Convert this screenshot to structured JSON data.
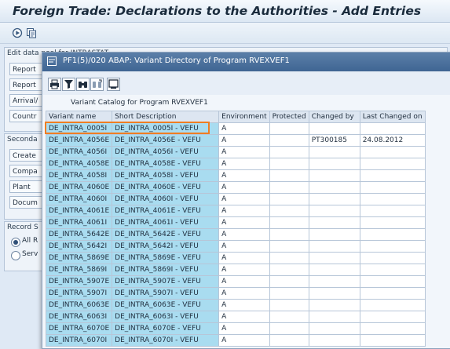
{
  "window": {
    "title": "Foreign Trade: Declarations to the Authorities - Add Entries"
  },
  "toolbar": {
    "icons": [
      "execute-icon",
      "variant-icon"
    ]
  },
  "edit_pool": {
    "title": "Edit data pool for INTRASTAT",
    "rows": [
      "Report",
      "Report",
      "Arrival/",
      "Countr"
    ]
  },
  "secondary": {
    "title": "Seconda",
    "rows": [
      "Create",
      "Compa",
      "Plant",
      "Docum"
    ]
  },
  "record": {
    "title": "Record S",
    "options": [
      {
        "label": "All R",
        "selected": true
      },
      {
        "label": "Serv",
        "selected": false
      }
    ]
  },
  "dialog": {
    "title": "PF1(5)/020 ABAP: Variant Directory of Program RVEXVEF1",
    "toolbar_icons": [
      "print-icon",
      "filter-icon",
      "find-icon",
      "find-next-icon",
      "display-icon"
    ],
    "catalog_label": "Variant Catalog for Program RVEXVEF1",
    "columns": [
      "Variant name",
      "Short Description",
      "Environment",
      "Protected",
      "Changed by",
      "Last Changed on"
    ],
    "rows": [
      [
        "DE_INTRA_0005I",
        "DE_INTRA_0005I - VEFU",
        "A",
        "",
        "",
        ""
      ],
      [
        "DE_INTRA_4056E",
        "DE_INTRA_4056E - VEFU",
        "A",
        "",
        "PT300185",
        "24.08.2012"
      ],
      [
        "DE_INTRA_4056I",
        "DE_INTRA_4056I - VEFU",
        "A",
        "",
        "",
        ""
      ],
      [
        "DE_INTRA_4058E",
        "DE_INTRA_4058E - VEFU",
        "A",
        "",
        "",
        ""
      ],
      [
        "DE_INTRA_4058I",
        "DE_INTRA_4058I - VEFU",
        "A",
        "",
        "",
        ""
      ],
      [
        "DE_INTRA_4060E",
        "DE_INTRA_4060E - VEFU",
        "A",
        "",
        "",
        ""
      ],
      [
        "DE_INTRA_4060I",
        "DE_INTRA_4060I - VEFU",
        "A",
        "",
        "",
        ""
      ],
      [
        "DE_INTRA_4061E",
        "DE_INTRA_4061E - VEFU",
        "A",
        "",
        "",
        ""
      ],
      [
        "DE_INTRA_4061I",
        "DE_INTRA_4061I - VEFU",
        "A",
        "",
        "",
        ""
      ],
      [
        "DE_INTRA_5642E",
        "DE_INTRA_5642E - VEFU",
        "A",
        "",
        "",
        ""
      ],
      [
        "DE_INTRA_5642I",
        "DE_INTRA_5642I - VEFU",
        "A",
        "",
        "",
        ""
      ],
      [
        "DE_INTRA_5869E",
        "DE_INTRA_5869E - VEFU",
        "A",
        "",
        "",
        ""
      ],
      [
        "DE_INTRA_5869I",
        "DE_INTRA_5869I - VEFU",
        "A",
        "",
        "",
        ""
      ],
      [
        "DE_INTRA_5907E",
        "DE_INTRA_5907E - VEFU",
        "A",
        "",
        "",
        ""
      ],
      [
        "DE_INTRA_5907I",
        "DE_INTRA_5907I - VEFU",
        "A",
        "",
        "",
        ""
      ],
      [
        "DE_INTRA_6063E",
        "DE_INTRA_6063E - VEFU",
        "A",
        "",
        "",
        ""
      ],
      [
        "DE_INTRA_6063I",
        "DE_INTRA_6063I - VEFU",
        "A",
        "",
        "",
        ""
      ],
      [
        "DE_INTRA_6070E",
        "DE_INTRA_6070E - VEFU",
        "A",
        "",
        "",
        ""
      ],
      [
        "DE_INTRA_6070I",
        "DE_INTRA_6070I - VEFU",
        "A",
        "",
        "",
        ""
      ]
    ],
    "selected_row": 0
  },
  "colors": {
    "accent": "#ef7d22",
    "key_column": "#a9dcf0",
    "dialog_title": "#3f6593"
  }
}
